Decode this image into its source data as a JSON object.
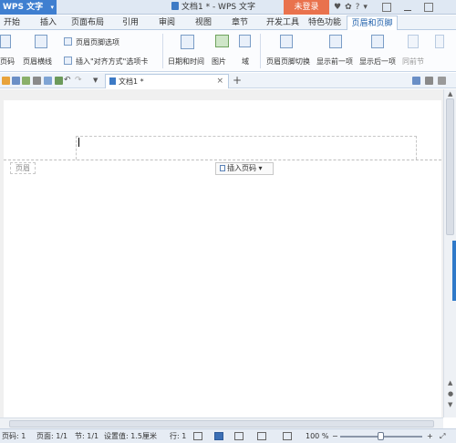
{
  "titlebar": {
    "app_name": "WPS 文字",
    "window_title": "文档1 * - WPS 文字",
    "login_button": "未登录",
    "help": "?"
  },
  "tabs": [
    "开始",
    "插入",
    "页面布局",
    "引用",
    "审阅",
    "视图",
    "章节",
    "开发工具",
    "特色功能",
    "页眉和页脚"
  ],
  "active_tab": "页眉和页脚",
  "ribbon": {
    "page_number": "页码",
    "header_line": "页眉横线",
    "header_footer_options": "页眉页脚选项",
    "insert_align_tab": "插入\"对齐方式\"选项卡",
    "date_time": "日期和时间",
    "picture": "图片",
    "field": "域",
    "switch_header_footer": "页眉页脚切换",
    "show_prev": "显示前一项",
    "show_next": "显示后一项",
    "same_as_prev": "同前节"
  },
  "doc_tab": {
    "label": "文档1 *",
    "close": "×",
    "new": "+"
  },
  "page": {
    "header_label": "页眉",
    "insert_page_number": "插入页码"
  },
  "status": {
    "page_no": "页码: 1",
    "pages": "页面: 1/1",
    "section": "节: 1/1",
    "setting": "设置值: 1.5厘米",
    "line": "行: 1",
    "zoom": "100 %"
  }
}
